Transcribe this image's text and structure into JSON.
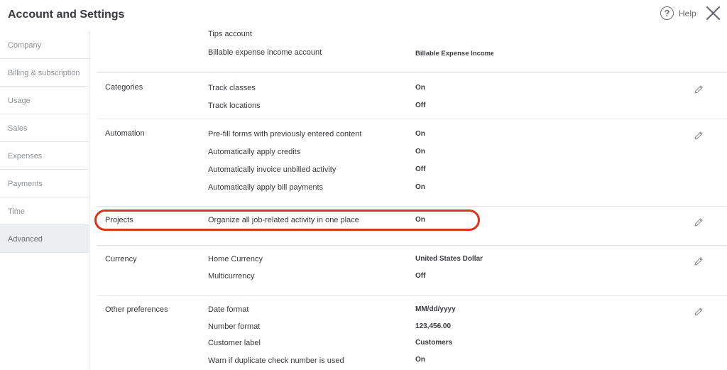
{
  "header": {
    "title": "Account and Settings",
    "help_label": "Help",
    "help_symbol": "?"
  },
  "sidebar": {
    "items": [
      {
        "label": "Company"
      },
      {
        "label": "Billing & subscription"
      },
      {
        "label": "Usage"
      },
      {
        "label": "Sales"
      },
      {
        "label": "Expenses"
      },
      {
        "label": "Payments"
      },
      {
        "label": "Time"
      },
      {
        "label": "Advanced"
      }
    ],
    "active": "Advanced"
  },
  "sections": {
    "expenses_accounts": {
      "rows": [
        {
          "label": "Tips account",
          "value": ""
        },
        {
          "label": "Billable expense income account",
          "value": "Billable Expense Income"
        }
      ]
    },
    "categories": {
      "title": "Categories",
      "rows": [
        {
          "label": "Track classes",
          "value": "On"
        },
        {
          "label": "Track locations",
          "value": "Off"
        }
      ]
    },
    "automation": {
      "title": "Automation",
      "rows": [
        {
          "label": "Pre-fill forms with previously entered content",
          "value": "On"
        },
        {
          "label": "Automatically apply credits",
          "value": "On"
        },
        {
          "label": "Automatically invoice unbilled activity",
          "value": "Off"
        },
        {
          "label": "Automatically apply bill payments",
          "value": "On"
        }
      ]
    },
    "projects": {
      "title": "Projects",
      "rows": [
        {
          "label": "Organize all job-related activity in one place",
          "value": "On"
        }
      ]
    },
    "currency": {
      "title": "Currency",
      "rows": [
        {
          "label": "Home Currency",
          "value": "United States Dollar"
        },
        {
          "label": "Multicurrency",
          "value": "Off"
        }
      ]
    },
    "other": {
      "title": "Other preferences",
      "rows": [
        {
          "label": "Date format",
          "value": "MM/dd/yyyy"
        },
        {
          "label": "Number format",
          "value": "123,456.00"
        },
        {
          "label": "Customer label",
          "value": "Customers"
        },
        {
          "label": "Warn if duplicate check number is used",
          "value": "On"
        }
      ]
    }
  },
  "colors": {
    "highlight": "#e0311b",
    "text": "#393a3d",
    "muted": "#8d9096",
    "divider": "#e3e5e8"
  },
  "icons": {
    "help": "question-circle-icon",
    "close": "close-x-icon",
    "edit": "pencil-icon"
  }
}
